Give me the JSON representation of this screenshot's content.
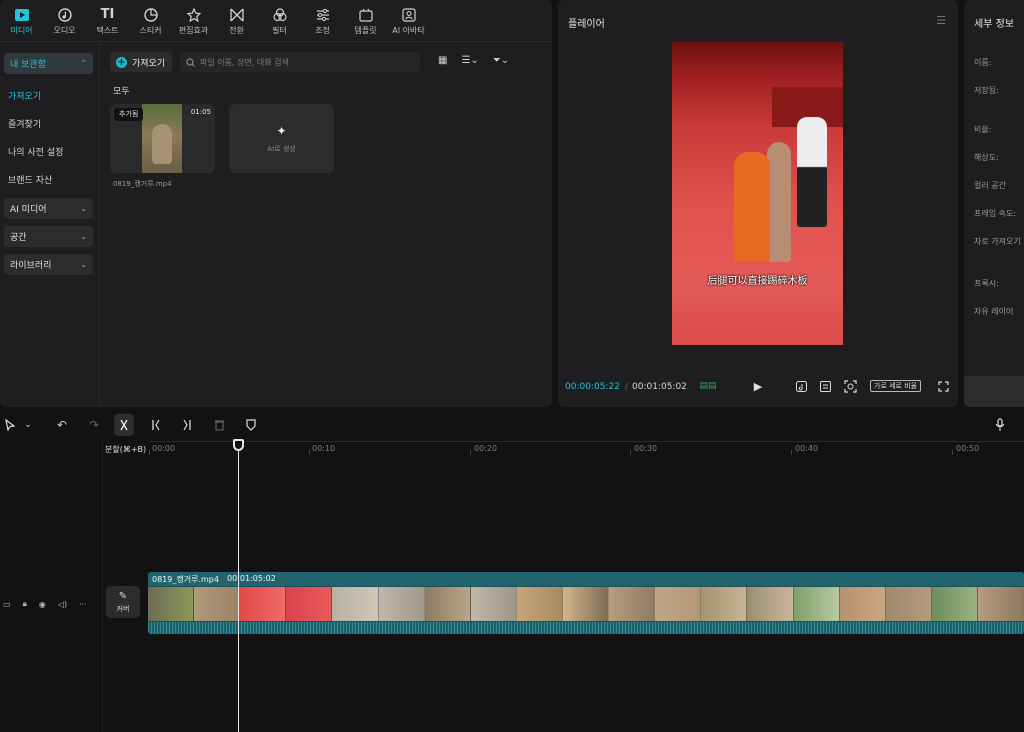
{
  "toolbar": {
    "tools": [
      {
        "label": "미디어",
        "icon": "media-icon"
      },
      {
        "label": "오디오",
        "icon": "audio-icon"
      },
      {
        "label": "텍스트",
        "icon": "text-icon"
      },
      {
        "label": "스티커",
        "icon": "sticker-icon"
      },
      {
        "label": "편집효과",
        "icon": "effects-icon"
      },
      {
        "label": "전환",
        "icon": "transition-icon"
      },
      {
        "label": "필터",
        "icon": "filter-icon"
      },
      {
        "label": "조정",
        "icon": "adjust-icon"
      },
      {
        "label": "템플릿",
        "icon": "template-icon"
      },
      {
        "label": "AI 아바타",
        "icon": "ai-avatar-icon"
      }
    ]
  },
  "sidebar": {
    "my_library": "내 보관함",
    "items": [
      "가져오기",
      "즐겨찾기",
      "나의 사전 설정",
      "브랜드 자산"
    ],
    "groups": [
      "AI 미디어",
      "공간",
      "라이브러리"
    ]
  },
  "media": {
    "import_label": "가져오기",
    "search_placeholder": "파일 이름, 장면, 대화 검색",
    "section_label": "모두",
    "clip": {
      "added_tag": "추가됨",
      "duration": "01:05",
      "name": "0819_캥거루.mp4"
    },
    "ai_card_label": "AI로 생성"
  },
  "player": {
    "title": "플레이어",
    "subtitle": "后腿可以直接踢碎木板",
    "current_time": "00:00:05:22",
    "separator": "/",
    "total_time": "00:01:05:02",
    "ratio_label": "가로 세로 비율"
  },
  "info": {
    "title": "세부 정보",
    "labels": [
      "이름:",
      "저장됨:",
      "비율:",
      "해상도:",
      "컬러 공간",
      "프레임 속도:",
      "자로 가져오기",
      "프록시:",
      "자유 레이어"
    ]
  },
  "timeline": {
    "split_tooltip": "분할(⌘+B)",
    "ticks": [
      "00:00",
      "00:10",
      "00:20",
      "00:30",
      "00:40",
      "00:50"
    ],
    "cover_label": "커버",
    "clip_name": "0819_캥거루.mp4",
    "clip_duration": "00:01:05:02"
  },
  "colors": {
    "accent": "#21c4d8",
    "clip": "#1e4f57"
  }
}
